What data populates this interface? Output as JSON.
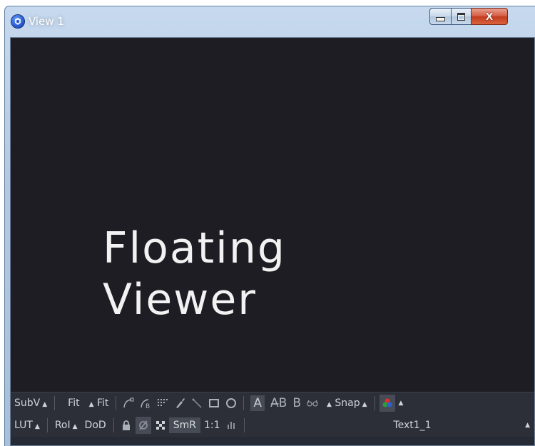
{
  "window": {
    "title": "View 1",
    "minimize_icon": "minimize-icon",
    "maximize_icon": "maximize-icon",
    "close_label": "X"
  },
  "viewer": {
    "overlay_text": "Floating\nViewer"
  },
  "toolbar_top": {
    "subv_label": "SubV",
    "fit1_label": "Fit",
    "fit2_label": "Fit",
    "a_label": "A",
    "ab_label": "A̶B",
    "b_label": "B",
    "snap_label": "Snap",
    "icons": [
      "polyline-icon",
      "bspline-icon",
      "grid-icon",
      "paint-icon",
      "wand-icon",
      "rectangle-icon",
      "ellipse-icon",
      "stereo-glasses-icon",
      "color-channels-icon"
    ]
  },
  "toolbar_bottom": {
    "lut_label": "LUT",
    "roi_label": "RoI",
    "dod_label": "DoD",
    "smr_label": "SmR",
    "ratio_label": "1:1",
    "node_name": "Text1_1",
    "icons": [
      "lock-icon",
      "proxy-off-icon",
      "checker-icon",
      "histogram-icon"
    ]
  }
}
